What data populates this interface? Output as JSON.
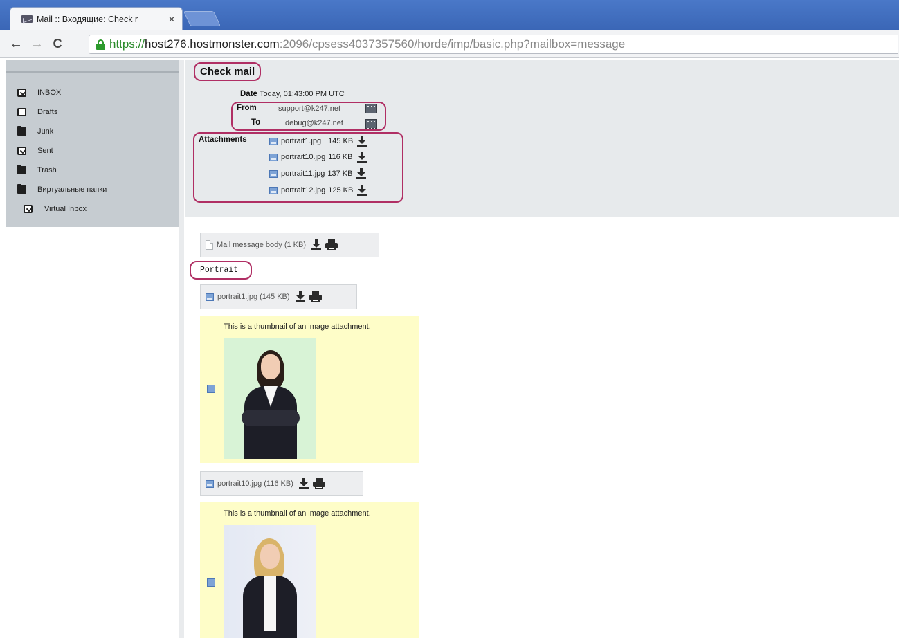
{
  "browser": {
    "tab_title": "Mail :: Входящие: Check r",
    "tab_close": "✕",
    "back": "←",
    "forward": "→",
    "reload": "C",
    "url": {
      "scheme": "https://",
      "host": "host276.hostmonster.com",
      "rest": ":2096/cpsess4037357560/horde/imp/basic.php?mailbox=message"
    }
  },
  "sidebar": {
    "folders": [
      {
        "label": "INBOX",
        "icon": "inbox-icon"
      },
      {
        "label": "Drafts",
        "icon": "drafts-icon"
      },
      {
        "label": "Junk",
        "icon": "folder-icon"
      },
      {
        "label": "Sent",
        "icon": "sent-icon"
      },
      {
        "label": "Trash",
        "icon": "folder-icon"
      },
      {
        "label": "Виртуальные папки",
        "icon": "folder-icon"
      },
      {
        "label": "Virtual Inbox",
        "icon": "inbox-icon"
      }
    ]
  },
  "message": {
    "subject": "Check mail",
    "date_label": "Date",
    "date_value": "Today, 01:43:00 PM UTC",
    "from_label": "From",
    "from_value": "support@k247.net",
    "to_label": "To",
    "to_value": "debug@k247.net",
    "attachments_label": "Attachments",
    "attachments": [
      {
        "name": "portrait1.jpg",
        "size": "145 KB"
      },
      {
        "name": "portrait10.jpg",
        "size": "116 KB"
      },
      {
        "name": "portrait11.jpg",
        "size": "137 KB"
      },
      {
        "name": "portrait12.jpg",
        "size": "125 KB"
      }
    ]
  },
  "body": {
    "mail_part_label": "Mail message body (1 KB)",
    "text": "Portrait",
    "image_parts": [
      {
        "label": "portrait1.jpg (145 KB)",
        "caption": "This is a thumbnail of an image attachment."
      },
      {
        "label": "portrait10.jpg (116 KB)",
        "caption": "This is a thumbnail of an image attachment."
      }
    ]
  },
  "colors": {
    "highlight_ring": "#b02f64",
    "sidebar_bg": "#c6ccd1",
    "header_bg": "#e7eaec",
    "thumbnail_bg": "#fefdc8",
    "tabbar_bg": "#4a78c8"
  }
}
